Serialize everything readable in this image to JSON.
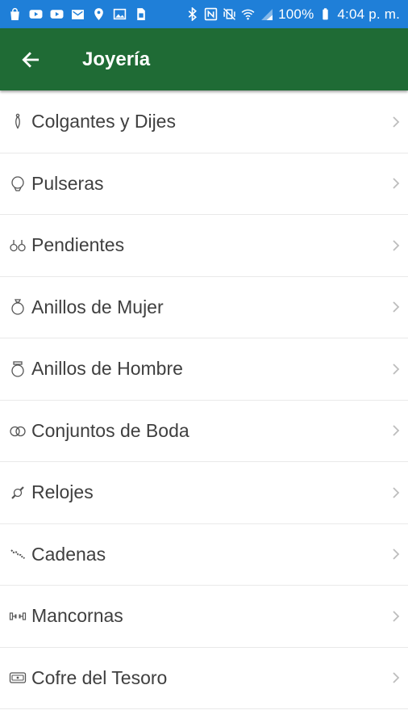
{
  "status_bar": {
    "battery_percent": "100%",
    "time": "4:04 p. m.",
    "left_icons": [
      "shopping-bag-icon",
      "youtube-icon",
      "youtube-icon",
      "gmail-icon",
      "location-pin-icon",
      "image-icon",
      "sim-icon"
    ],
    "right_icons": [
      "bluetooth-icon",
      "nfc-icon",
      "vibrate-off-icon",
      "wifi-icon",
      "signal-icon",
      "battery-icon"
    ]
  },
  "app_bar": {
    "title": "Joyería",
    "back_icon": "arrow-left-icon",
    "background": "#1f6b35"
  },
  "categories": [
    {
      "label": "Colgantes y Dijes",
      "icon": "pendant-icon"
    },
    {
      "label": "Pulseras",
      "icon": "bracelet-icon"
    },
    {
      "label": "Pendientes",
      "icon": "earrings-icon"
    },
    {
      "label": "Anillos de Mujer",
      "icon": "womens-ring-icon"
    },
    {
      "label": "Anillos de Hombre",
      "icon": "mens-ring-icon"
    },
    {
      "label": "Conjuntos de Boda",
      "icon": "wedding-rings-icon"
    },
    {
      "label": "Relojes",
      "icon": "watch-icon"
    },
    {
      "label": "Cadenas",
      "icon": "chain-icon"
    },
    {
      "label": "Mancornas",
      "icon": "cufflinks-icon"
    },
    {
      "label": "Cofre del Tesoro",
      "icon": "treasure-chest-icon"
    }
  ],
  "colors": {
    "status_bar": "#1f7fd8",
    "app_bar": "#1f6b35",
    "text": "#3f3f3f",
    "chevron": "#bdbdbd"
  }
}
